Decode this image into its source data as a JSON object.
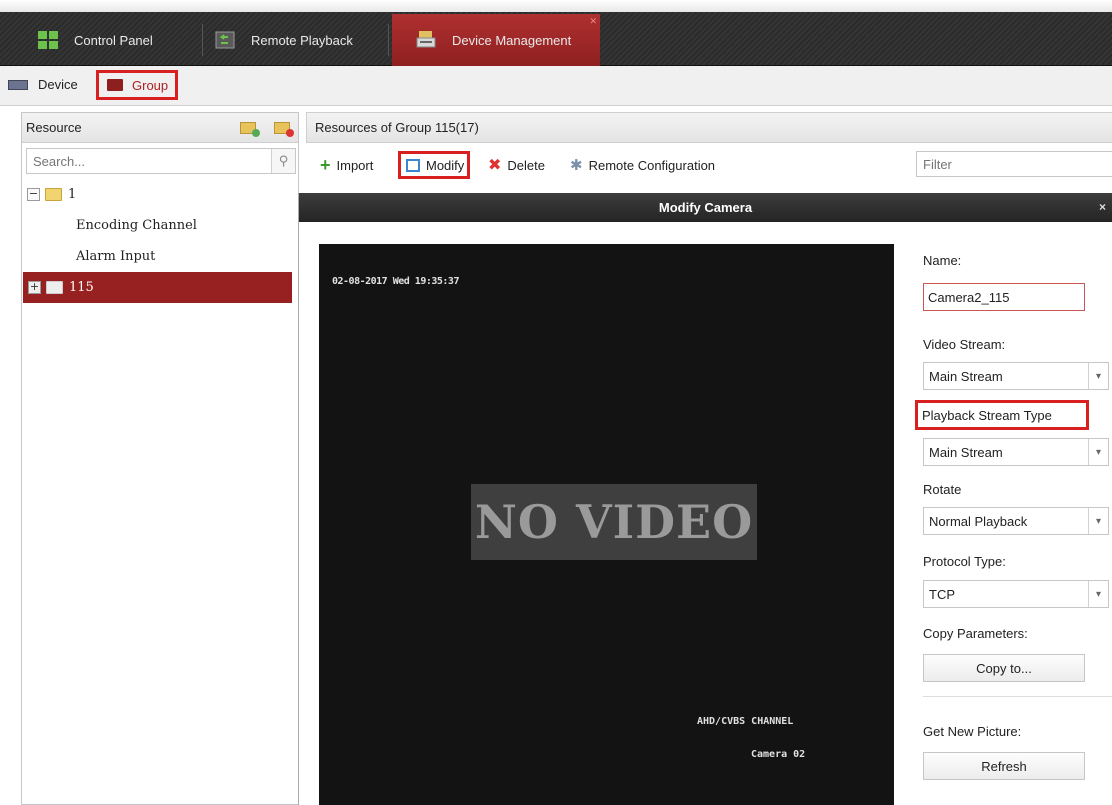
{
  "tabs": [
    {
      "label": "Control Panel"
    },
    {
      "label": "Remote Playback"
    },
    {
      "label": "Device Management",
      "active": true
    }
  ],
  "subtabs": {
    "device": "Device",
    "group": "Group"
  },
  "resource": {
    "title": "Resource",
    "search_placeholder": "Search...",
    "tree": [
      {
        "label": "1",
        "expander": "−"
      },
      {
        "label": "Encoding Channel"
      },
      {
        "label": "Alarm Input"
      },
      {
        "label": "115",
        "expander": "+",
        "selected": true
      }
    ]
  },
  "main": {
    "title": "Resources of Group 115(17)",
    "toolbar": {
      "import": "Import",
      "modify": "Modify",
      "delete": "Delete",
      "remote_config": "Remote Configuration",
      "filter_placeholder": "Filter"
    }
  },
  "modal": {
    "title": "Modify Camera",
    "close": "×",
    "video": {
      "timestamp": "02-08-2017 Wed 19:35:37",
      "no_video": "NO VIDEO",
      "channel": "AHD/CVBS CHANNEL",
      "camera": "Camera 02"
    },
    "form": {
      "name_label": "Name:",
      "name_value": "Camera2_115",
      "video_stream_label": "Video Stream:",
      "video_stream_value": "Main Stream",
      "playback_label": "Playback Stream Type",
      "playback_value": "Main Stream",
      "rotate_label": "Rotate",
      "rotate_value": "Normal Playback",
      "protocol_label": "Protocol Type:",
      "protocol_value": "TCP",
      "copy_label": "Copy Parameters:",
      "copy_button": "Copy to...",
      "new_picture_label": "Get New Picture:",
      "refresh_button": "Refresh"
    }
  },
  "colors": {
    "accent": "#972121",
    "highlight_border": "#d92020"
  }
}
